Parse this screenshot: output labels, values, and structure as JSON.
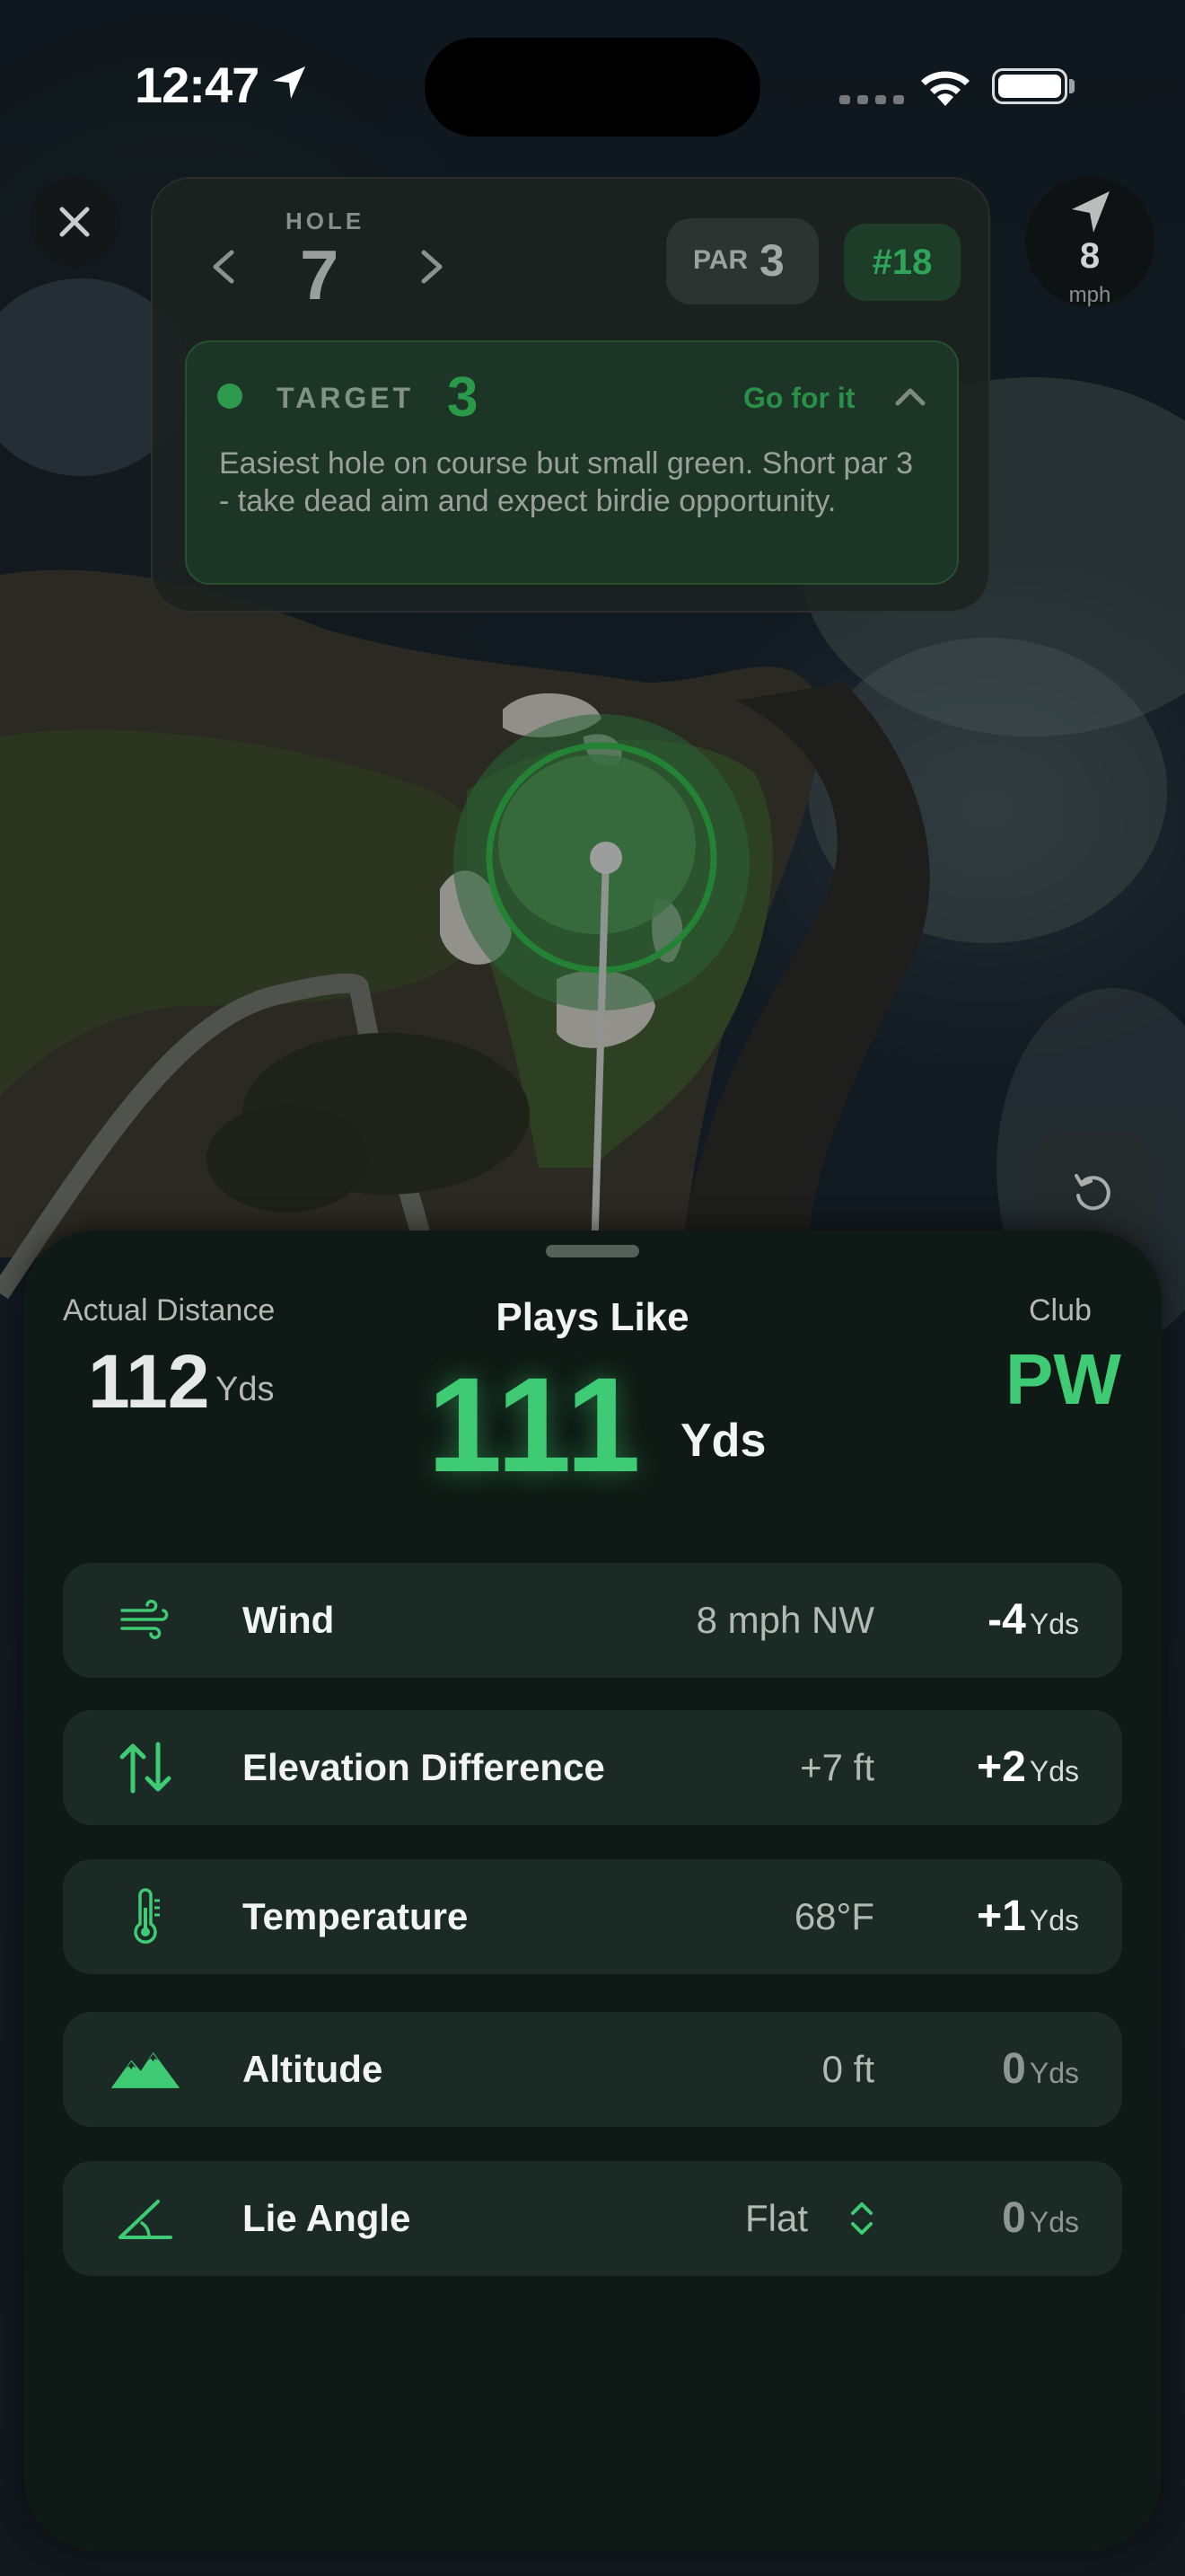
{
  "status_bar": {
    "time": "12:47"
  },
  "hole": {
    "label": "HOLE",
    "number": "7",
    "par_label": "PAR",
    "par_value": "3",
    "handicap": "#18",
    "target_label": "TARGET",
    "target_value": "3",
    "target_action": "Go for it",
    "description": "Easiest hole on course but small green. Short par 3 - take dead aim and expect birdie opportunity."
  },
  "wind_indicator": {
    "speed": "8",
    "unit": "mph"
  },
  "summary": {
    "actual_label": "Actual Distance",
    "actual_value": "112",
    "actual_unit": "Yds",
    "plays_like_label": "Plays Like",
    "plays_like_value": "111",
    "plays_like_unit": "Yds",
    "club_label": "Club",
    "club_value": "PW"
  },
  "factors": [
    {
      "name": "Wind",
      "reading": "8 mph NW",
      "adjustment": "-4",
      "unit": "Yds",
      "icon": "wind-icon"
    },
    {
      "name": "Elevation Difference",
      "reading": "+7 ft",
      "adjustment": "+2",
      "unit": "Yds",
      "icon": "elevation-arrows-icon"
    },
    {
      "name": "Temperature",
      "reading": "68°F",
      "adjustment": "+1",
      "unit": "Yds",
      "icon": "thermometer-icon"
    },
    {
      "name": "Altitude",
      "reading": "0 ft",
      "adjustment": "0",
      "unit": "Yds",
      "icon": "mountains-icon"
    },
    {
      "name": "Lie Angle",
      "reading": "Flat",
      "adjustment": "0",
      "unit": "Yds",
      "icon": "angle-icon"
    }
  ],
  "colors": {
    "accent": "#3ecb73",
    "sheet": "#0f1915",
    "row": "#1b2a24"
  }
}
